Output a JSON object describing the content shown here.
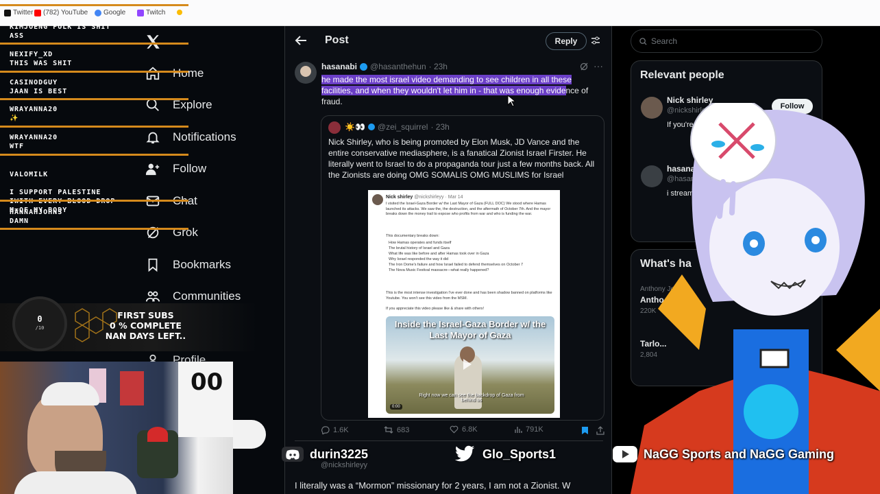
{
  "browser": {
    "bookmarks": [
      {
        "label": "Twitter",
        "icon": "x-icon"
      },
      {
        "label": "(782) YouTube",
        "icon": "youtube-icon"
      },
      {
        "label": "Google",
        "icon": "google-icon"
      },
      {
        "label": "Twitch",
        "icon": "twitch-icon"
      }
    ]
  },
  "chat": [
    {
      "user": "KIMJOENG FOLK IS SHIT",
      "msg": "ASS"
    },
    {
      "user": "NEXIFY_XD",
      "msg": "THIS WAS SHIT"
    },
    {
      "user": "CASINODGUY",
      "msg": "JAAN IS BEST"
    },
    {
      "user": "WRAYANNA20",
      "msg": "✨"
    },
    {
      "user": "WRAYANNA20",
      "msg": "WTF"
    },
    {
      "user": "VALOMILK",
      "msg": "I SUPPORT PALESTINE\nIWITH EVERY BLOOD DROP\nM=OF MY BODY"
    },
    {
      "user": "HANNAHJOHNS",
      "msg": "DAMN"
    }
  ],
  "nav": {
    "items": [
      {
        "label": "Home",
        "icon": "home-icon"
      },
      {
        "label": "Explore",
        "icon": "search-icon"
      },
      {
        "label": "Notifications",
        "icon": "bell-icon"
      },
      {
        "label": "Follow",
        "icon": "follow-icon"
      },
      {
        "label": "Chat",
        "icon": "mail-icon"
      },
      {
        "label": "Grok",
        "icon": "grok-icon"
      },
      {
        "label": "Bookmarks",
        "icon": "bookmark-icon"
      },
      {
        "label": "Communities",
        "icon": "communities-icon"
      },
      {
        "label": "Profile",
        "icon": "profile-icon"
      }
    ]
  },
  "goal": {
    "count": "0",
    "target": "/10",
    "line1": "FIRST SUBS",
    "line2": "0 % COMPLETE",
    "line3": "NAN DAYS LEFT.."
  },
  "post": {
    "header": "Post",
    "reply_button": "Reply",
    "author": "hasanabi",
    "handle": "@hasanthehun",
    "time": "· 23h",
    "text_highlighted": "he made the most israel video demanding to see children in all these facilities, and when they wouldn't let him in - that was enough evide",
    "text_rest": "nce of fraud.",
    "quote": {
      "author": "☀️👀",
      "handle": "@zei_squirrel",
      "time": "· 23h",
      "text": "Nick Shirley, who is being promoted by Elon Musk, JD Vance and the entire conservative mediasphere, is a fanatical Zionist Israel Firster. He literally went to Israel to do a propaganda tour just a few months back. All the Zionists are doing OMG SOMALIS OMG MUSLIMS for Israel",
      "embed": {
        "author": "Nick shirley",
        "handle": "@nickshirleyy · Mar 14",
        "intro": "I visited the Israel-Gaza Border w/ the Last Mayor of Gaza (FULL DOC) We stood where Hamas launched its attacks. We saw the, the destruction, and the aftermath of October 7th. And the mayor breaks down the money trail to expose who profits from war and who is funding the war.",
        "lead": "This documentary breaks down:",
        "bullets": [
          "How Hamas operates and funds itself",
          "The brutal history of Israel and Gaza",
          "What life was like before and after Hamas took over in Gaza",
          "Why Israel responded the way it did",
          "The Iron Dome's failure and how Israel failed to defend themselves on October 7",
          "The Nova Music Festival massacre—what really happened?"
        ],
        "para": "This is the most intense investigation I've ever done and has been shadow banned on platforms like Youtube. You won't see this video from the MSM.",
        "cta": "If you appreciate this video please like & share with others!",
        "thumb_title": "Inside the Israel-Gaza Border w/ the Last Mayor of Gaza",
        "caption": "Right now we can see the backdrop of Gaza from behind us",
        "duration": "0:00"
      }
    },
    "stats": {
      "replies": "1.6K",
      "reposts": "683",
      "likes": "6.8K",
      "views": "791K"
    },
    "next_handle": "@nickshirleyy",
    "next_text": "I literally was a “Mormon” missionary for 2 years, I am not a Zionist. W"
  },
  "right": {
    "search_placeholder": "Search",
    "relevant_title": "Relevant people",
    "people": [
      {
        "name": "Nick shirley",
        "handle": "@nickshirleyy",
        "bio": "If you're reading this... button",
        "follow": "Follow"
      },
      {
        "name": "hasanabi",
        "handle": "@hasanthehun",
        "bio": "i stream on twitch.tv... hasan... mailto:H..."
      }
    ],
    "whats_title": "What's ha",
    "trends": [
      {
        "meta": "Anthony Jo...",
        "title": "Antho...",
        "count": "220K"
      },
      {
        "meta": "",
        "title": "Tarlo...",
        "count": "2,804"
      }
    ]
  },
  "socials": [
    {
      "icon": "discord-icon",
      "label": "durin3225"
    },
    {
      "icon": "twitter-bird-icon",
      "label": "Glo_Sports1"
    },
    {
      "icon": "youtube-icon",
      "label": "NaGG Sports and NaGG Gaming"
    }
  ],
  "colors": {
    "accent": "#1d9bf0",
    "highlight": "#6b3fc7",
    "chat_line": "#d58a1c",
    "bg": "#0b0e13"
  }
}
